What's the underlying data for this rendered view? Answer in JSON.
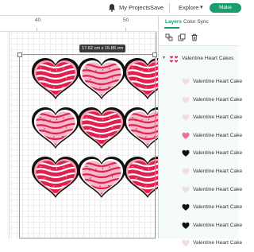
{
  "topbar": {
    "my_projects": "My Projects",
    "save": "Save",
    "explore": "Explore",
    "make_label": "Make",
    "accent": "#1b9e6b"
  },
  "canvas": {
    "ruler_ticks": [
      "40",
      "50"
    ],
    "dimensions": "17.62 cm x 15.85 cm"
  },
  "panel": {
    "tabs": [
      {
        "label": "Layers",
        "active": true
      },
      {
        "label": "Color Sync",
        "active": false
      }
    ],
    "tools": [
      "group-icon",
      "duplicate-icon",
      "delete-icon"
    ],
    "group_label": "Valentine Heart Cakes",
    "layers": [
      {
        "label": "Valentine Heart Cake",
        "swatch": "#f2dede"
      },
      {
        "label": "Valentine Heart Cake",
        "swatch": "#f2dede"
      },
      {
        "label": "Valentine Heart Cake",
        "swatch": "#f2dede"
      },
      {
        "label": "Valentine Heart Cake",
        "swatch": "#f06f95"
      },
      {
        "label": "Valentine Heart Cake",
        "swatch": "#111111"
      },
      {
        "label": "Valentine Heart Cake",
        "swatch": "#f2dede"
      },
      {
        "label": "Valentine Heart Cake",
        "swatch": "#f2dede"
      },
      {
        "label": "Valentine Heart Cake",
        "swatch": "#111111"
      },
      {
        "label": "Valentine Heart Cake",
        "swatch": "#111111"
      },
      {
        "label": "Valentine Heart Cake",
        "swatch": "#f2dede"
      }
    ]
  },
  "hearts": [
    {
      "variant": "red"
    },
    {
      "variant": "pink"
    },
    {
      "variant": "red"
    },
    {
      "variant": "pink"
    },
    {
      "variant": "red"
    },
    {
      "variant": "pink"
    },
    {
      "variant": "red"
    },
    {
      "variant": "pink"
    },
    {
      "variant": "red"
    }
  ]
}
